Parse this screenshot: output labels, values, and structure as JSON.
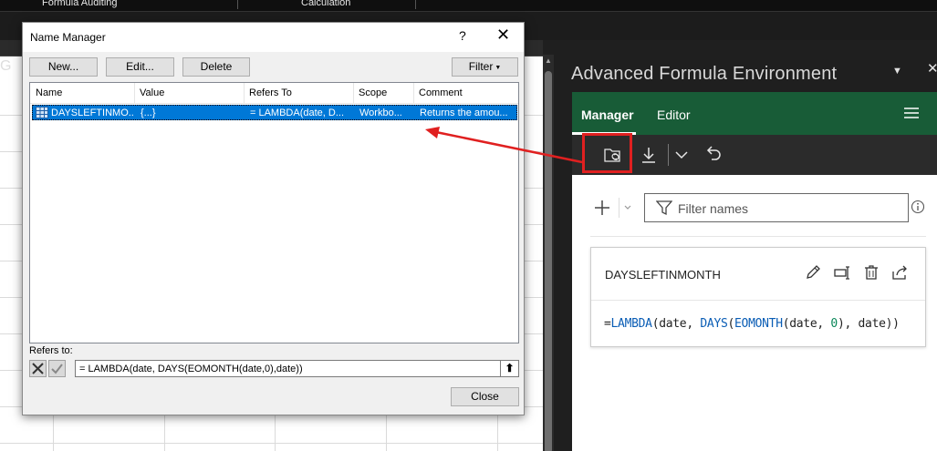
{
  "ribbon": {
    "groups": [
      "Formula Auditing",
      "Calculation"
    ]
  },
  "sheet": {
    "partial_glyph": "G"
  },
  "dialog": {
    "title": "Name Manager",
    "help": "?",
    "buttons": {
      "new": "New...",
      "edit": "Edit...",
      "delete": "Delete",
      "filter": "Filter",
      "close": "Close"
    },
    "columns": [
      "Name",
      "Value",
      "Refers To",
      "Scope",
      "Comment"
    ],
    "rows": [
      {
        "name": "DAYSLEFTINMO...",
        "value": "{...}",
        "refers_to": "= LAMBDA(date, D...",
        "scope": "Workbo...",
        "comment": "Returns the amou..."
      }
    ],
    "refers_to_label": "Refers to:",
    "refers_to_value": "= LAMBDA(date, DAYS(EOMONTH(date,0),date))"
  },
  "afe": {
    "title": "Advanced Formula Environment",
    "tabs": [
      "Manager",
      "Editor"
    ],
    "active_tab": "Manager",
    "filter_placeholder": "Filter names",
    "card": {
      "name": "DAYSLEFTINMONTH",
      "formula": {
        "p1": "=",
        "f1": "LAMBDA",
        "p2": "(date, ",
        "f2": "DAYS",
        "p3": "(",
        "f3": "EOMONTH",
        "p4": "(date, ",
        "n1": "0",
        "p5": "), date))"
      }
    },
    "colors": {
      "nav_green": "#185c37",
      "highlight_red": "#e02020",
      "selection_blue": "#0078d7"
    }
  }
}
